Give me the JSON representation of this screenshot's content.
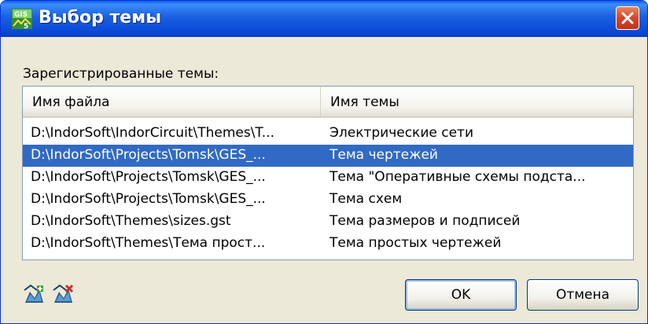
{
  "dialog": {
    "title": "Выбор темы",
    "section_label": "Зарегистрированные темы:",
    "columns": [
      "Имя файла",
      "Имя темы"
    ],
    "rows": [
      {
        "file": "D:\\IndorSoft\\IndorCircuit\\Themes\\T...",
        "name": "Электрические сети",
        "selected": false
      },
      {
        "file": "D:\\IndorSoft\\Projects\\Tomsk\\GES_...",
        "name": "Тема чертежей",
        "selected": true
      },
      {
        "file": "D:\\IndorSoft\\Projects\\Tomsk\\GES_...",
        "name": "Тема \"Оперативные схемы подста...",
        "selected": false
      },
      {
        "file": "D:\\IndorSoft\\Projects\\Tomsk\\GES_...",
        "name": "Тема схем",
        "selected": false
      },
      {
        "file": "D:\\IndorSoft\\Themes\\sizes.gst",
        "name": "Тема размеров и подписей",
        "selected": false
      },
      {
        "file": "D:\\IndorSoft\\Themes\\Тема прост...",
        "name": "Тема простых чертежей",
        "selected": false
      }
    ],
    "ok_label": "OK",
    "cancel_label": "Отмена",
    "tool_icons": [
      "add-theme-icon",
      "remove-theme-icon"
    ],
    "selection_color": "#316ac5"
  }
}
